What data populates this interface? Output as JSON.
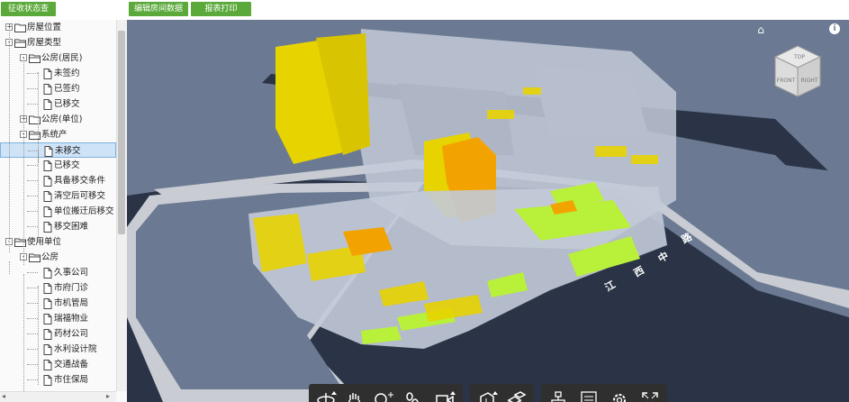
{
  "header": {
    "status_button": "征收状态查看",
    "edit_button": "编辑房间数据",
    "print_button": "报表打印"
  },
  "tree": [
    {
      "label": "房屋位置",
      "level": 0,
      "toggle": "+",
      "icon": "folder-icon"
    },
    {
      "label": "房屋类型",
      "level": 0,
      "toggle": "-",
      "icon": "folder-open-icon"
    },
    {
      "label": "公房(居民)",
      "level": 1,
      "toggle": "-",
      "icon": "folder-open-icon"
    },
    {
      "label": "未签约",
      "level": 2,
      "toggle": "",
      "icon": "document-icon"
    },
    {
      "label": "已签约",
      "level": 2,
      "toggle": "",
      "icon": "document-icon"
    },
    {
      "label": "已移交",
      "level": 2,
      "toggle": "",
      "icon": "document-icon"
    },
    {
      "label": "公房(单位)",
      "level": 1,
      "toggle": "+",
      "icon": "folder-icon"
    },
    {
      "label": "系统产",
      "level": 1,
      "toggle": "-",
      "icon": "folder-open-icon"
    },
    {
      "label": "未移交",
      "level": 2,
      "toggle": "",
      "icon": "document-icon",
      "selected": true
    },
    {
      "label": "已移交",
      "level": 2,
      "toggle": "",
      "icon": "document-icon"
    },
    {
      "label": "具备移交条件",
      "level": 2,
      "toggle": "",
      "icon": "document-icon"
    },
    {
      "label": "清空后可移交",
      "level": 2,
      "toggle": "",
      "icon": "document-icon"
    },
    {
      "label": "单位搬迁后移交",
      "level": 2,
      "toggle": "",
      "icon": "document-icon"
    },
    {
      "label": "移交困难",
      "level": 2,
      "toggle": "",
      "icon": "document-icon"
    },
    {
      "label": "使用单位",
      "level": 0,
      "toggle": "-",
      "icon": "folder-open-icon"
    },
    {
      "label": "公房",
      "level": 1,
      "toggle": "-",
      "icon": "folder-open-icon"
    },
    {
      "label": "久事公司",
      "level": 2,
      "toggle": "",
      "icon": "document-icon"
    },
    {
      "label": "市府门诊",
      "level": 2,
      "toggle": "",
      "icon": "document-icon"
    },
    {
      "label": "市机管局",
      "level": 2,
      "toggle": "",
      "icon": "document-icon"
    },
    {
      "label": "瑞福物业",
      "level": 2,
      "toggle": "",
      "icon": "document-icon"
    },
    {
      "label": "药材公司",
      "level": 2,
      "toggle": "",
      "icon": "document-icon"
    },
    {
      "label": "水利设计院",
      "level": 2,
      "toggle": "",
      "icon": "document-icon"
    },
    {
      "label": "交通战备",
      "level": 2,
      "toggle": "",
      "icon": "document-icon"
    },
    {
      "label": "市住保局",
      "level": 2,
      "toggle": "",
      "icon": "document-icon"
    }
  ],
  "viewer": {
    "road_label_chars": [
      "江",
      "西",
      "中",
      "路"
    ],
    "cube_labels": {
      "top": "TOP",
      "front": "FRONT",
      "right": "RIGHT"
    },
    "colors": {
      "background": "#6b7a92",
      "road": "#2b3447",
      "sidewalk": "#c9ccd3",
      "building": "#c3cad8",
      "yellow": "#e7d300",
      "orange": "#f3a300",
      "lime": "#b9f03a",
      "toolbar": "#2f2f2f"
    },
    "toolbar_icons": [
      "orbit-icon",
      "pan-icon",
      "zoom-icon",
      "walk-icon",
      "camera-icon",
      "section-icon",
      "explode-icon",
      "model-tree-icon",
      "properties-icon",
      "settings-icon",
      "fullscreen-icon"
    ]
  }
}
